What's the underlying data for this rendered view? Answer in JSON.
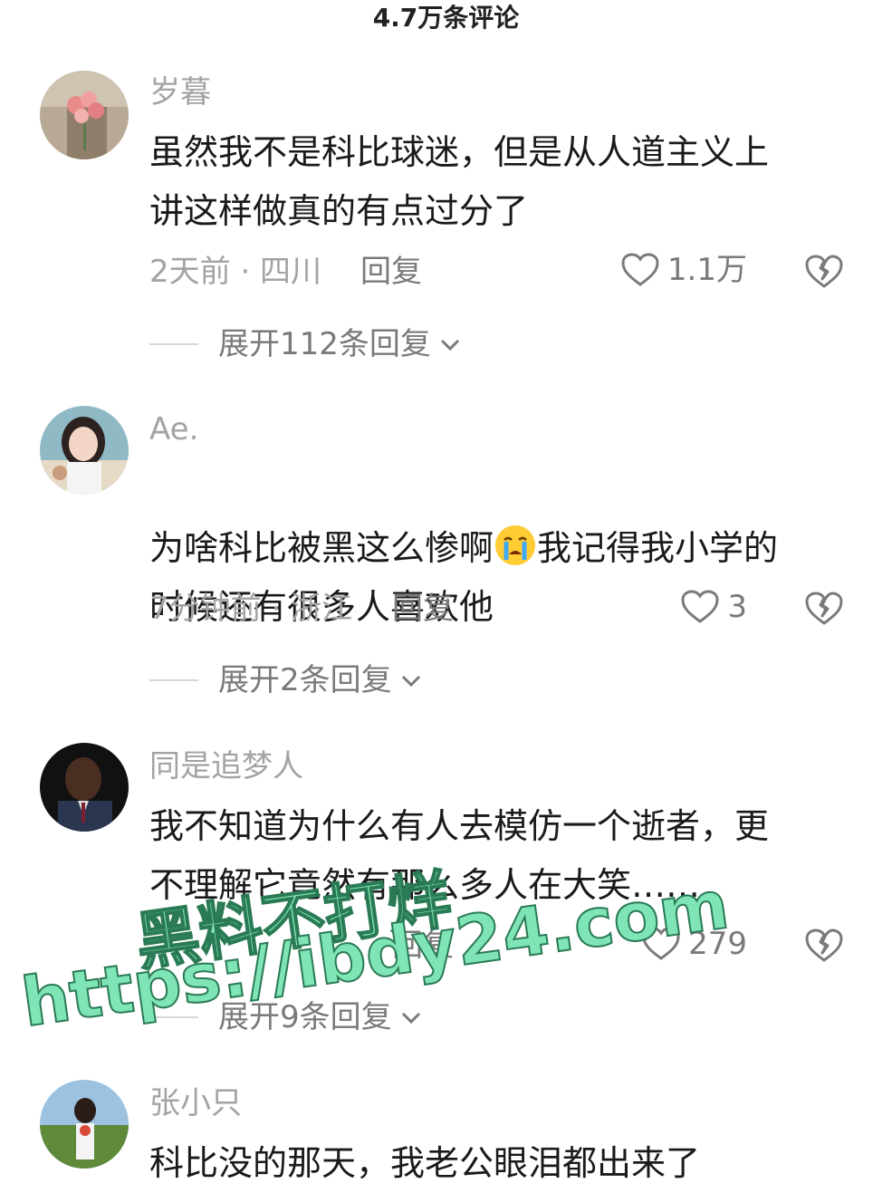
{
  "header": {
    "title": "4.7万条评论"
  },
  "comments": [
    {
      "username": "岁暮",
      "content": "虽然我不是科比球迷，但是从人道主义上\n讲这样做真的有点过分了",
      "time_location": "2天前 · 四川",
      "reply_label": "回复",
      "likes": "1.1万",
      "expand_label": "展开112条回复"
    },
    {
      "username": "Ae.",
      "content_before_emoji": "为啥科比被黑这么惨啊",
      "emoji": "crying-emoji",
      "content_after_emoji": "我记得我小学的\n时候还有很多人喜欢他",
      "time_location": "7分钟前 · 浙江",
      "reply_label": "回复",
      "likes": "3",
      "expand_label": "展开2条回复"
    },
    {
      "username": "同是追梦人",
      "content": "我不知道为什么有人去模仿一个逝者，更\n不理解它竟然有那么多人在大笑……",
      "reply_label": "回复",
      "likes": "279",
      "expand_label": "展开9条回复"
    },
    {
      "username": "张小只",
      "content": "科比没的那天，我老公眼泪都出来了"
    }
  ],
  "watermark": {
    "line1": "黑料不打烊",
    "line2": "https://ibdy24.com"
  },
  "colors": {
    "muted_text": "#a3a3a3",
    "action_text": "#7a7a7a",
    "watermark": "#7fe4b6"
  }
}
